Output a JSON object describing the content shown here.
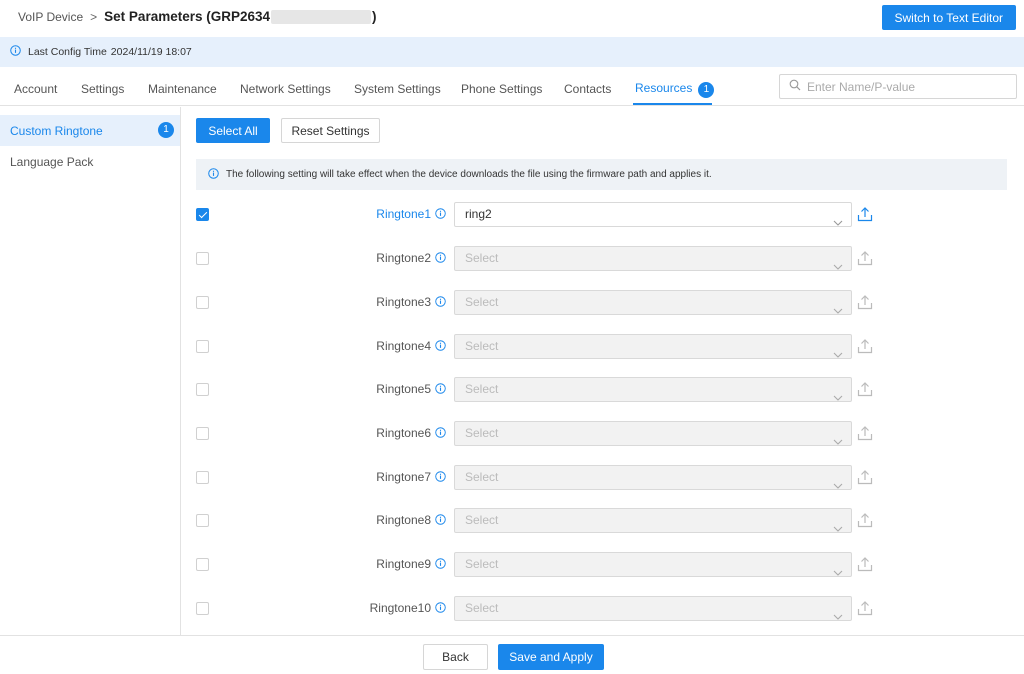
{
  "header": {
    "breadcrumb_root": "VoIP Device",
    "breadcrumb_sep": ">",
    "title": "Set Parameters (GRP2634",
    "title_end": ")",
    "switch_label": "Switch to Text Editor"
  },
  "info_bar": {
    "label": "Last Config Time",
    "value": "2024/11/19 18:07"
  },
  "tabs": [
    {
      "label": "Account"
    },
    {
      "label": "Settings"
    },
    {
      "label": "Maintenance"
    },
    {
      "label": "Network Settings"
    },
    {
      "label": "System Settings"
    },
    {
      "label": "Phone Settings"
    },
    {
      "label": "Contacts"
    },
    {
      "label": "Resources",
      "badge": "1"
    }
  ],
  "search": {
    "placeholder": "Enter Name/P-value"
  },
  "sidebar": {
    "items": [
      {
        "label": "Custom Ringtone",
        "badge": "1"
      },
      {
        "label": "Language Pack"
      }
    ]
  },
  "actions": {
    "select_all": "Select All",
    "reset": "Reset Settings"
  },
  "notice": "The following setting will take effect when the device downloads the file using the firmware path and applies it.",
  "rows": [
    {
      "label": "Ringtone1",
      "value": "ring2"
    },
    {
      "label": "Ringtone2",
      "value": "Select"
    },
    {
      "label": "Ringtone3",
      "value": "Select"
    },
    {
      "label": "Ringtone4",
      "value": "Select"
    },
    {
      "label": "Ringtone5",
      "value": "Select"
    },
    {
      "label": "Ringtone6",
      "value": "Select"
    },
    {
      "label": "Ringtone7",
      "value": "Select"
    },
    {
      "label": "Ringtone8",
      "value": "Select"
    },
    {
      "label": "Ringtone9",
      "value": "Select"
    },
    {
      "label": "Ringtone10",
      "value": "Select"
    }
  ],
  "footer": {
    "back": "Back",
    "save": "Save and Apply"
  },
  "colors": {
    "accent": "#1a87eb",
    "info_bar_bg": "#e6f0fc",
    "notice_bg": "#eef2f6"
  },
  "icons": [
    "info-icon",
    "search-icon",
    "chevron-down-icon",
    "upload-icon",
    "check-icon"
  ]
}
